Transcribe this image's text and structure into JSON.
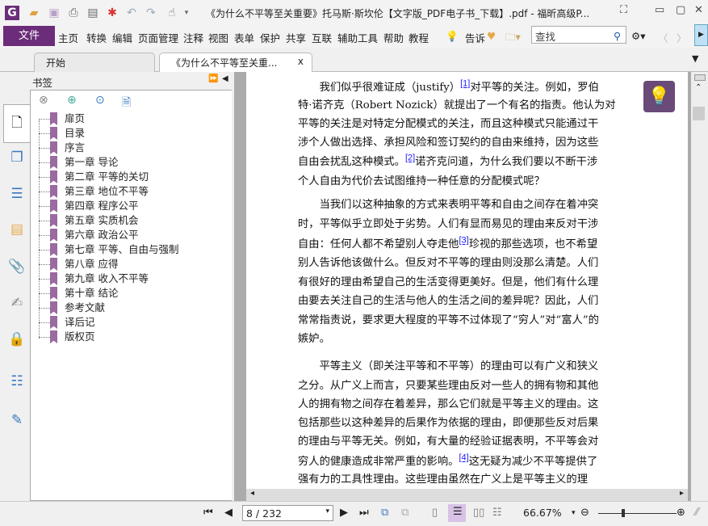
{
  "titlebar": {
    "title": "《为什么不平等至关重要》托马斯·斯坎伦【文字版_PDF电子书_下载】.pdf - 福昕高级P...",
    "app_icon": "G"
  },
  "menu": {
    "file": "文件",
    "items": [
      "主页",
      "转换",
      "编辑",
      "页面管理",
      "注释",
      "视图",
      "表单",
      "保护",
      "共享",
      "互联",
      "辅助工具",
      "帮助",
      "教程"
    ],
    "tell": "告诉",
    "search_placeholder": "查找"
  },
  "tabs": [
    {
      "label": "开始"
    },
    {
      "label": "《为什么不平等至关重...",
      "close": "x"
    }
  ],
  "panel": {
    "title": "书签",
    "bookmarks": [
      "扉页",
      "目录",
      "序言",
      "第一章 导论",
      "第二章 平等的关切",
      "第三章 地位不平等",
      "第四章 程序公平",
      "第五章 实质机会",
      "第六章 政治公平",
      "第七章 平等、自由与强制",
      "第八章 应得",
      "第九章 收入不平等",
      "第十章 结论",
      "参考文献",
      "译后记",
      "版权页"
    ]
  },
  "document": {
    "lines": [
      [
        {
          "t": "　　我们似乎很难证成（justify）"
        },
        {
          "r": "[1]"
        },
        {
          "t": "对平等的关注。例如，罗伯"
        }
      ],
      [
        {
          "t": "特·诺齐克（Robert Nozick）就提出了一个有名的指责。他认为对"
        }
      ],
      [
        {
          "t": "平等的关注是对特定分配模式的关注，而且这种模式只能通过干"
        }
      ],
      [
        {
          "t": "涉个人做出选择、承担风险和签订契约的自由来维持，因为这些"
        }
      ],
      [
        {
          "t": "自由会扰乱这种模式。"
        },
        {
          "r": "[2]"
        },
        {
          "t": "诺齐克问道，为什么我们要以不断干涉"
        }
      ],
      [
        {
          "t": "个人自由为代价去试图维持一种任意的分配模式呢？"
        }
      ],
      [
        {
          "t": "　　当我们以这种抽象的方式来表明平等和自由之间存在着冲突"
        }
      ],
      [
        {
          "t": "时，平等似乎立即处于劣势。人们有显而易见的理由来反对干涉"
        }
      ],
      [
        {
          "t": "自由：任何人都不希望别人夺走他"
        },
        {
          "r": "[3]"
        },
        {
          "t": "珍视的那些选项，也不希望"
        }
      ],
      [
        {
          "t": "别人告诉他该做什么。但反对不平等的理由则没那么清楚。人们"
        }
      ],
      [
        {
          "t": "有很好的理由希望自己的生活变得更美好。但是，他们有什么理"
        }
      ],
      [
        {
          "t": "由要去关注自己的生活与他人的生活之间的差异呢？因此，人们"
        }
      ],
      [
        {
          "t": "常常指责说，要求更大程度的平等不过体现了“穷人”对“富人”的"
        }
      ],
      [
        {
          "t": "嫉妒。"
        }
      ],
      [
        {
          "t": "　　平等主义（即关注平等和不平等）的理由可以有广义和狭义"
        }
      ],
      [
        {
          "t": "之分。从广义上而言，只要某些理由反对一些人的拥有物和其他"
        }
      ],
      [
        {
          "t": "人的拥有物之间存在着差异，那么它们就是平等主义的理由。这"
        }
      ],
      [
        {
          "t": "包括那些以这种差异的后果作为依据的理由，即便那些反对后果"
        }
      ],
      [
        {
          "t": "的理由与平等无关。例如，有大量的经验证据表明，不平等会对"
        }
      ],
      [
        {
          "t": "穷人的健康造成非常严重的影响。"
        },
        {
          "r": "[4]"
        },
        {
          "t": "这无疑为减少不平等提供了"
        }
      ],
      [
        {
          "t": "强有力的工具性理由。这些理由虽然在广义上是平等主义的理"
        }
      ]
    ]
  },
  "status": {
    "page": "8 / 232",
    "zoom": "66.67%"
  },
  "colors": {
    "accent": "#6b2d7a",
    "bookmark": "#9a6aa0"
  }
}
